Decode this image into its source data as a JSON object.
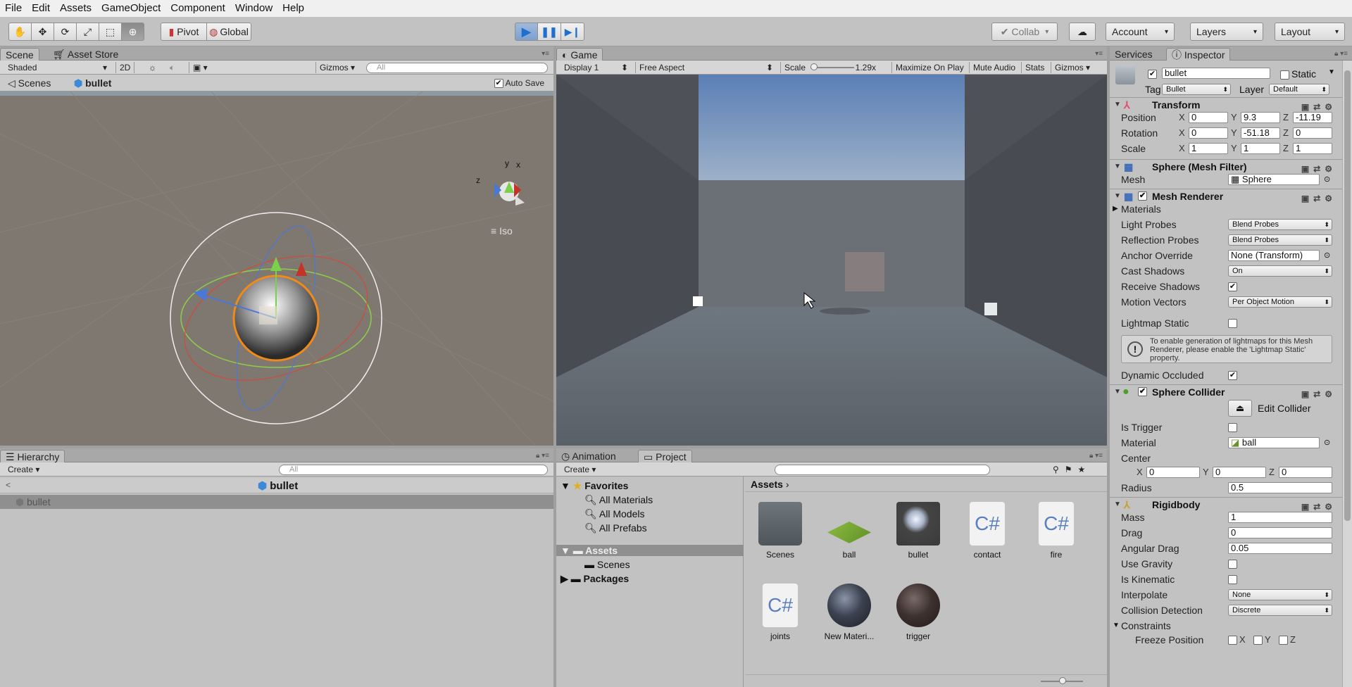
{
  "menu": [
    "File",
    "Edit",
    "Assets",
    "GameObject",
    "Component",
    "Window",
    "Help"
  ],
  "toolbar": {
    "pivot": "Pivot",
    "global": "Global",
    "collab": "Collab",
    "account": "Account",
    "layers": "Layers",
    "layout": "Layout"
  },
  "scene": {
    "tabs": [
      "Scene",
      "Asset Store"
    ],
    "shading": "Shaded",
    "mode2d": "2D",
    "gizmos": "Gizmos",
    "search_placeholder": "All",
    "breadcrumb_root": "Scenes",
    "breadcrumb_item": "bullet",
    "autosave": "Auto Save",
    "iso": "Iso",
    "axis_y": "y",
    "axis_x": "x",
    "axis_z": "z"
  },
  "game": {
    "tab": "Game",
    "display": "Display 1",
    "aspect": "Free Aspect",
    "scale_label": "Scale",
    "scale_value": "1.29x",
    "maximize": "Maximize On Play",
    "mute": "Mute Audio",
    "stats": "Stats",
    "gizmos": "Gizmos"
  },
  "hierarchy": {
    "tab": "Hierarchy",
    "create": "Create",
    "search_placeholder": "All",
    "title": "bullet",
    "items": [
      "bullet"
    ]
  },
  "project": {
    "tabs": [
      "Animation",
      "Project"
    ],
    "create": "Create",
    "favorites_label": "Favorites",
    "favorites": [
      "All Materials",
      "All Models",
      "All Prefabs"
    ],
    "tree_assets": "Assets",
    "tree_scenes": "Scenes",
    "tree_packages": "Packages",
    "breadcrumb": "Assets",
    "assets": [
      {
        "name": "Scenes",
        "type": "folder"
      },
      {
        "name": "ball",
        "type": "physic-material"
      },
      {
        "name": "bullet",
        "type": "prefab"
      },
      {
        "name": "contact",
        "type": "script"
      },
      {
        "name": "fire",
        "type": "script"
      },
      {
        "name": "joints",
        "type": "script"
      },
      {
        "name": "New Materi...",
        "type": "material"
      },
      {
        "name": "trigger",
        "type": "material"
      }
    ]
  },
  "inspector": {
    "tabs": [
      "Services",
      "Inspector"
    ],
    "object_name": "bullet",
    "static_label": "Static",
    "tag_label": "Tag",
    "tag_value": "Bullet",
    "layer_label": "Layer",
    "layer_value": "Default",
    "transform": {
      "title": "Transform",
      "position_label": "Position",
      "rotation_label": "Rotation",
      "scale_label": "Scale",
      "position": [
        "0",
        "9.3",
        "-11.19"
      ],
      "rotation": [
        "0",
        "-51.18",
        "0"
      ],
      "scale": [
        "1",
        "1",
        "1"
      ]
    },
    "mesh_filter": {
      "title": "Sphere (Mesh Filter)",
      "mesh_label": "Mesh",
      "mesh_value": "Sphere"
    },
    "mesh_renderer": {
      "title": "Mesh Renderer",
      "materials": "Materials",
      "light_probes_label": "Light Probes",
      "light_probes": "Blend Probes",
      "reflection_probes_label": "Reflection Probes",
      "reflection_probes": "Blend Probes",
      "anchor_label": "Anchor Override",
      "anchor": "None (Transform)",
      "cast_label": "Cast Shadows",
      "cast": "On",
      "receive_label": "Receive Shadows",
      "motion_label": "Motion Vectors",
      "motion": "Per Object Motion",
      "lightmap_label": "Lightmap Static",
      "help": "To enable generation of lightmaps for this Mesh Renderer, please enable the 'Lightmap Static' property.",
      "dynamic_label": "Dynamic Occluded"
    },
    "sphere_collider": {
      "title": "Sphere Collider",
      "edit": "Edit Collider",
      "trigger_label": "Is Trigger",
      "material_label": "Material",
      "material": "ball",
      "center_label": "Center",
      "center": [
        "0",
        "0",
        "0"
      ],
      "radius_label": "Radius",
      "radius": "0.5"
    },
    "rigidbody": {
      "title": "Rigidbody",
      "mass_label": "Mass",
      "mass": "1",
      "drag_label": "Drag",
      "drag": "0",
      "angular_label": "Angular Drag",
      "angular": "0.05",
      "gravity_label": "Use Gravity",
      "kinematic_label": "Is Kinematic",
      "interpolate_label": "Interpolate",
      "interpolate": "None",
      "collision_label": "Collision Detection",
      "collision": "Discrete",
      "constraints_label": "Constraints",
      "freeze_label": "Freeze Position"
    },
    "axes": [
      "X",
      "Y",
      "Z"
    ]
  },
  "colors": {
    "editor_bg": "#c2c2c2",
    "selection": "#3e7de7",
    "play_blue": "#1f6fd0"
  }
}
